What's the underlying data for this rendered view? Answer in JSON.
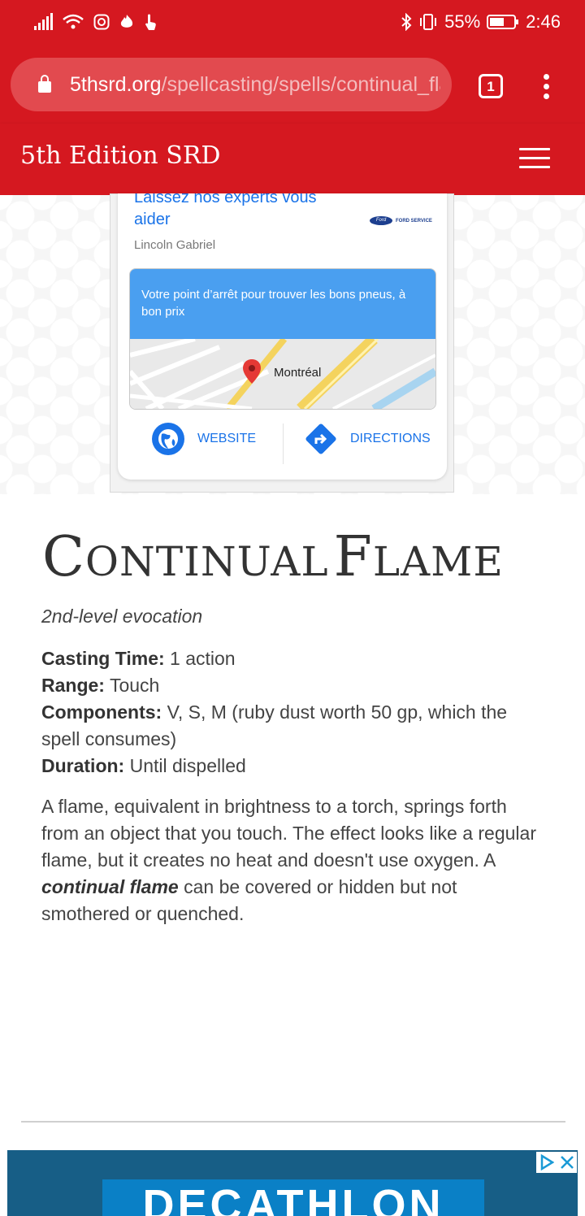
{
  "status_bar": {
    "battery": "55%",
    "time": "2:46"
  },
  "browser": {
    "url_host": "5thsrd.org",
    "url_path": "/spellcasting/spells/continual_flame",
    "tab_count": "1"
  },
  "site": {
    "title": "5th Edition SRD"
  },
  "ad": {
    "headline": "Laissez nos experts vous aider",
    "brand_badge": "Ford",
    "brand_service": "FORD SERVICE",
    "advertiser": "Lincoln Gabriel",
    "tagline": "Votre point d’arrêt pour trouver les bons pneus, à bon prix",
    "map_city": "Montréal",
    "website_label": "WEBSITE",
    "directions_label": "DIRECTIONS"
  },
  "spell": {
    "title_first_cap": "C",
    "title_first_rest": "ONTINUAL",
    "title_second_cap": "F",
    "title_second_rest": "LAME",
    "level": "2nd-level evocation",
    "casting_time_label": "Casting Time:",
    "casting_time": "1 action",
    "range_label": "Range:",
    "range": "Touch",
    "components_label": "Components:",
    "components": "V, S, M (ruby dust worth 50 gp, which the spell consumes)",
    "duration_label": "Duration:",
    "duration": "Until dispelled",
    "desc_part1": "A flame, equivalent in brightness to a torch, springs forth from an object that you touch. The effect looks like a regular flame, but it creates no heat and doesn't use oxygen. A ",
    "desc_em": "continual flame",
    "desc_part2": " can be covered or hidden but not smothered or quenched."
  },
  "bottom_ad": {
    "brand": "DECATHLON"
  },
  "colors": {
    "brand_red": "#d51820",
    "link_blue": "#1a73e8",
    "ad_blue": "#4a9ff0"
  }
}
